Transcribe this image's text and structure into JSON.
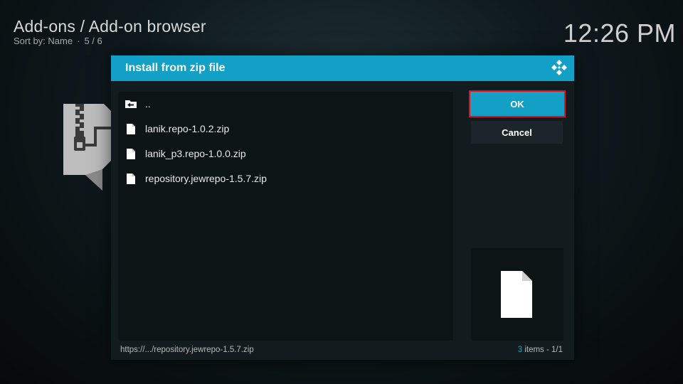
{
  "header": {
    "title": "Add-ons / Add-on browser",
    "sort_label": "Sort by: Name",
    "position": "5 / 6"
  },
  "clock": "12:26 PM",
  "dialog": {
    "title": "Install from zip file",
    "items": [
      {
        "label": "..",
        "icon": "folder-back-icon"
      },
      {
        "label": "lanik.repo-1.0.2.zip",
        "icon": "file-icon"
      },
      {
        "label": "lanik_p3.repo-1.0.0.zip",
        "icon": "file-icon"
      },
      {
        "label": "repository.jewrepo-1.5.7.zip",
        "icon": "file-icon"
      }
    ],
    "ok_label": "OK",
    "cancel_label": "Cancel",
    "footer_path": "https://.../repository.jewrepo-1.5.7.zip",
    "item_count": "3",
    "item_count_suffix": "items - 1/1"
  },
  "colors": {
    "accent": "#12a0c6",
    "focus_border": "#e0121f",
    "dialog_bg": "#121c1f",
    "list_bg": "#0c1416"
  }
}
